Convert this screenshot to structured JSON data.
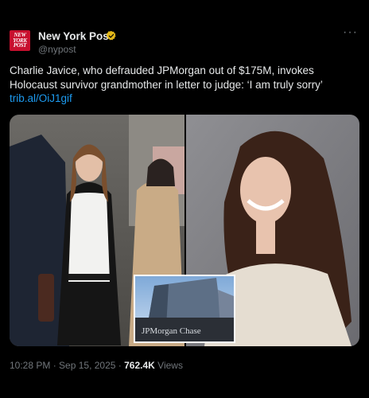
{
  "account": {
    "avatar_lines": [
      "NEW",
      "YORK",
      "POST"
    ],
    "name": "New York Post",
    "handle": "@nypost",
    "verified_icon": "verified-badge-icon",
    "verified_color": "#e2b719"
  },
  "post": {
    "line1": "Charlie Javice, who defrauded JPMorgan out of $175M, invokes",
    "line2": "Holocaust survivor grandmother in letter to judge: ‘I am truly sorry’",
    "link": "trib.al/OiJ1gif"
  },
  "media": {
    "inset_sign_text": "JPMorgan Chase"
  },
  "meta": {
    "time": "10:28 PM",
    "separator": " · ",
    "date": "Sep 15, 2025",
    "views_count": "762.4K",
    "views_label": "Views"
  },
  "colors": {
    "background": "#000000",
    "text": "#e7e9ea",
    "muted": "#71767b",
    "link": "#1d9bf0",
    "brand": "#c8102e"
  },
  "icons": {
    "more": "more-options-icon"
  }
}
